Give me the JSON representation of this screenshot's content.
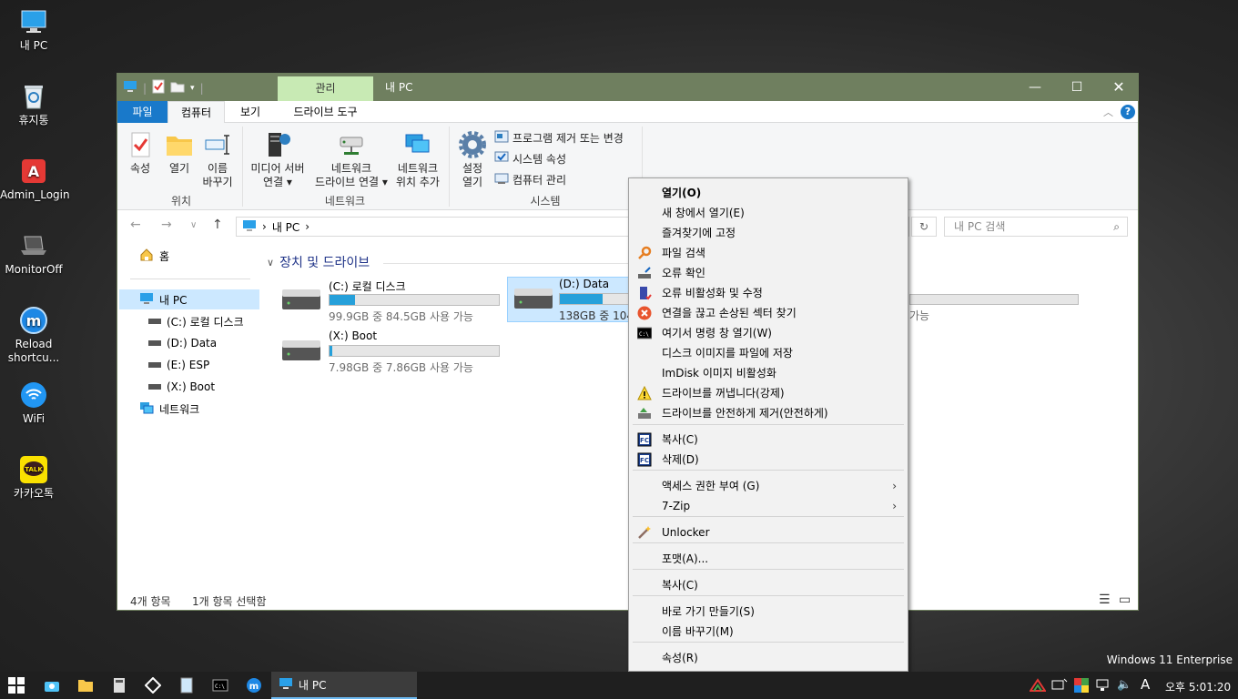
{
  "desktop": {
    "icons": [
      {
        "label": "내 PC",
        "icon": "computer-icon"
      },
      {
        "label": "휴지통",
        "icon": "recycle-bin-icon"
      },
      {
        "label": "Admin_Login",
        "icon": "admin-app-icon"
      },
      {
        "label": "MonitorOff",
        "icon": "laptop-icon"
      },
      {
        "label": "Reload shortcu...",
        "icon": "reload-icon"
      },
      {
        "label": "WiFi",
        "icon": "wifi-icon"
      },
      {
        "label": "카카오톡",
        "icon": "kakaotalk-icon"
      }
    ],
    "watermark": "Windows 11 Enterprise"
  },
  "window": {
    "title": "내 PC",
    "context_tab": "관리",
    "tabs": [
      "파일",
      "컴퓨터",
      "보기",
      "드라이브 도구"
    ],
    "active_tab": "컴퓨터",
    "accent": "#6f7f5f"
  },
  "ribbon": {
    "location": {
      "group_label": "위치",
      "properties": "속성",
      "open": "열기",
      "rename_1": "이름",
      "rename_2": "바꾸기"
    },
    "network": {
      "group_label": "네트워크",
      "media_1": "미디어 서버",
      "media_2": "연결 ▾",
      "map_1": "네트워크",
      "map_2": "드라이브 연결 ▾",
      "add_1": "네트워크",
      "add_2": "위치 추가"
    },
    "system": {
      "group_label": "시스템",
      "settings_1": "설정",
      "settings_2": "열기",
      "uninstall": "프로그램 제거 또는 변경",
      "sys_props": "시스템 속성",
      "manage": "컴퓨터 관리"
    }
  },
  "address": {
    "path": "내 PC",
    "search_placeholder": "내 PC 검색"
  },
  "nav": {
    "home": "홈",
    "this_pc": "내 PC",
    "drives": [
      "(C:) 로컬 디스크",
      "(D:) Data",
      "(E:) ESP",
      "(X:) Boot"
    ],
    "network": "네트워크"
  },
  "content": {
    "section": "장치 및 드라이브",
    "drives": [
      {
        "name": "(C:) 로컬 디스크",
        "size": "99.9GB 중 84.5GB 사용 가능",
        "used_fraction": 0.15
      },
      {
        "name": "(D:) Data",
        "size": "138GB 중 104",
        "used_fraction": 0.25
      },
      {
        "name": "(X:) Boot",
        "size": "7.98GB 중 7.86GB 사용 가능",
        "used_fraction": 0.015
      }
    ],
    "hidden_drive_size_tail": "가능"
  },
  "status": {
    "count": "4개 항목",
    "selected": "1개 항목 선택함"
  },
  "context_menu": {
    "items": [
      {
        "label": "열기(O)",
        "bold": true
      },
      {
        "label": "새 창에서 열기(E)"
      },
      {
        "label": "즐겨찾기에 고정"
      },
      {
        "label": "파일 검색",
        "icon": "search-key-icon"
      },
      {
        "label": "오류 확인",
        "icon": "drive-check-icon"
      },
      {
        "label": "오류 비활성화 및 수정",
        "icon": "disable-fix-icon"
      },
      {
        "label": "연결을 끊고 손상된 섹터 찾기",
        "icon": "error-x-icon"
      },
      {
        "label": "여기서 명령 창 열기(W)",
        "icon": "cmd-icon"
      },
      {
        "label": "디스크 이미지를 파일에 저장"
      },
      {
        "label": "ImDisk 이미지 비활성화"
      },
      {
        "label": "드라이브를 꺼냅니다(강제)",
        "icon": "warning-icon"
      },
      {
        "label": "드라이브를 안전하게 제거(안전하게)",
        "icon": "safe-remove-icon"
      },
      {
        "label": "복사(C)",
        "icon": "fastcopy-icon"
      },
      {
        "label": "삭제(D)",
        "icon": "fastcopy-icon"
      },
      {
        "label": "액세스 권한 부여 (G)",
        "submenu": true
      },
      {
        "label": "7-Zip",
        "submenu": true
      },
      {
        "label": "Unlocker",
        "icon": "wand-icon"
      },
      {
        "label": "포맷(A)..."
      },
      {
        "label": "복사(C)"
      },
      {
        "label": "바로 가기 만들기(S)"
      },
      {
        "label": "이름 바꾸기(M)"
      },
      {
        "label": "속성(R)"
      }
    ]
  },
  "taskbar": {
    "active_app": "내 PC",
    "clock": "오후 5:01:20",
    "ime": "A"
  }
}
